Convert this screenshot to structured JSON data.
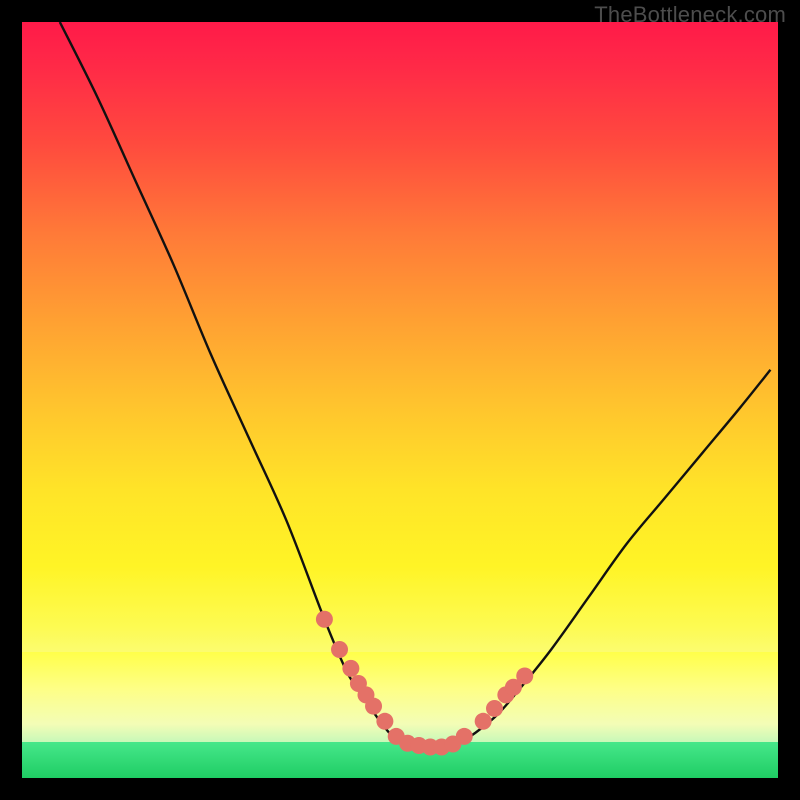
{
  "watermark": "TheBottleneck.com",
  "colors": {
    "curve_stroke": "#111111",
    "marker_fill": "#e47167",
    "marker_stroke": "#d9645a"
  },
  "chart_data": {
    "type": "line",
    "title": "",
    "xlabel": "",
    "ylabel": "",
    "xlim": [
      0,
      100
    ],
    "ylim": [
      0,
      100
    ],
    "grid": false,
    "legend": false,
    "series": [
      {
        "name": "bottleneck-curve",
        "x": [
          5,
          10,
          15,
          20,
          25,
          30,
          35,
          40,
          43,
          45,
          47,
          49,
          50,
          52,
          54,
          56,
          58,
          60,
          63,
          66,
          70,
          75,
          80,
          85,
          90,
          95,
          99
        ],
        "y": [
          100,
          90,
          79,
          68,
          56,
          45,
          34,
          21,
          14,
          11,
          8,
          5.5,
          4.8,
          4.3,
          4.1,
          4.2,
          4.8,
          6.0,
          8.5,
          12,
          17,
          24,
          31,
          37,
          43,
          49,
          54
        ]
      }
    ],
    "markers": {
      "name": "highlighted-points",
      "x": [
        40,
        42,
        43.5,
        44.5,
        45.5,
        46.5,
        48,
        49.5,
        51,
        52.5,
        54,
        55.5,
        57,
        58.5,
        61,
        62.5,
        64,
        65,
        66.5
      ],
      "y": [
        21,
        17,
        14.5,
        12.5,
        11,
        9.5,
        7.5,
        5.5,
        4.6,
        4.3,
        4.1,
        4.1,
        4.5,
        5.5,
        7.5,
        9.2,
        11,
        12,
        13.5
      ]
    }
  }
}
